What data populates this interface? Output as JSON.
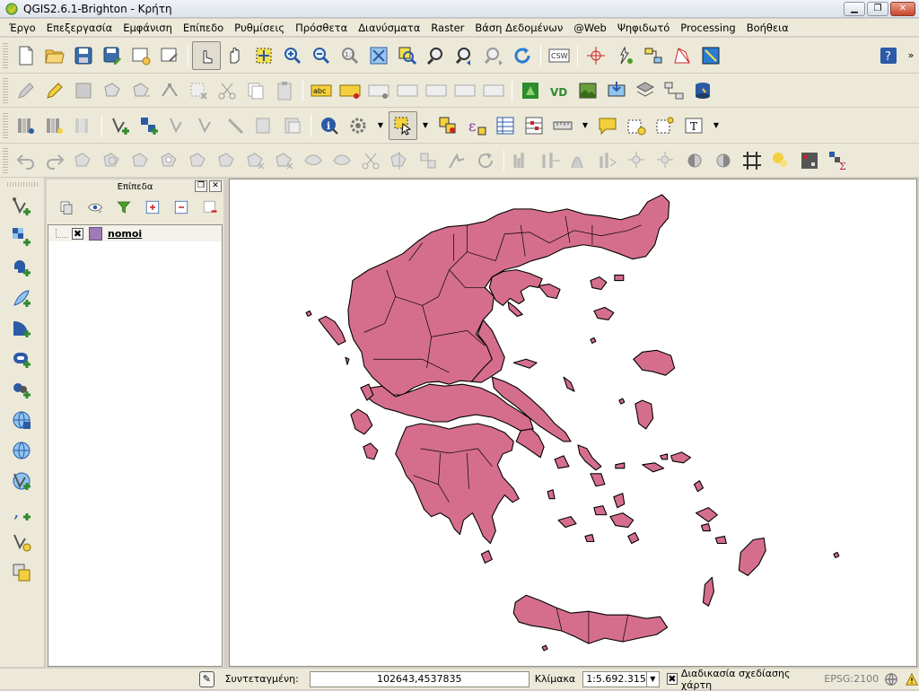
{
  "window": {
    "title": "QGIS2.6.1-Brighton - Κρήτη"
  },
  "menu": [
    "Έργο",
    "Επεξεργασία",
    "Εμφάνιση",
    "Επίπεδο",
    "Ρυθμίσεις",
    "Πρόσθετα",
    "Διανύσματα",
    "Raster",
    "Βάση Δεδομένων",
    "@Web",
    "Ψηφιδωτό",
    "Processing",
    "Βοήθεια"
  ],
  "toolbar_text": {
    "csw": "CSW",
    "abc": "abc",
    "overflow": "»"
  },
  "layers_panel": {
    "title": "Επίπεδα",
    "layers": [
      {
        "name": "nomoi",
        "checked": true,
        "color": "#9f7bb6"
      }
    ]
  },
  "map": {
    "fill_color": "#d56e8c",
    "stroke_color": "#000000",
    "background": "#ffffff"
  },
  "status": {
    "coord_label": "Συντεταγμένη:",
    "coord_value": "102643,4537835",
    "scale_label": "Κλίμακα",
    "scale_value": "1:5.692.315",
    "render_label": "Διαδικασία σχεδίασης χάρτη",
    "render_checked": true,
    "crs": "EPSG:2100"
  }
}
